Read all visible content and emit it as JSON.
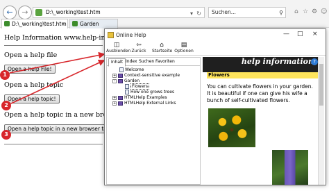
{
  "browser": {
    "url": "D:\\_working\\test.htm",
    "search_placeholder": "Suchen...",
    "tabs": [
      {
        "label": "D:\\_working\\test.htm"
      },
      {
        "label": "Garden"
      }
    ]
  },
  "page": {
    "header": "Help Information www.help-info.de",
    "sections": [
      {
        "text": "Open a help file",
        "button": "Open a help File!",
        "badge": "1"
      },
      {
        "text": "Open a help topic",
        "button": "Open a help topic!",
        "badge": "2"
      },
      {
        "text": "Open a help topic in a new browser tab",
        "button": "Open a help topic in a new browser tab!",
        "badge": "3"
      }
    ]
  },
  "help_window": {
    "title": "Online Help",
    "toolbar": [
      {
        "label": "Ausblenden",
        "icon": "hide-icon"
      },
      {
        "label": "Zurück",
        "icon": "back-icon"
      },
      {
        "label": "Startseite",
        "icon": "home-icon"
      },
      {
        "label": "Optionen",
        "icon": "options-icon"
      }
    ],
    "nav_tabs": [
      "Inhalt",
      "Index",
      "Suchen",
      "Favoriten"
    ],
    "tree": [
      {
        "label": "Welcome",
        "type": "page"
      },
      {
        "label": "Context-sensitive example",
        "type": "book"
      },
      {
        "label": "Garden",
        "type": "book"
      },
      {
        "label": "Flowers",
        "type": "page"
      },
      {
        "label": "How one grows trees",
        "type": "page"
      },
      {
        "label": "HTMLHelp Examples",
        "type": "book"
      },
      {
        "label": "HTMLHelp External Links",
        "type": "book"
      }
    ],
    "content": {
      "logo_text": "help information",
      "heading": "Flowers",
      "body": "You can cultivate flowers in your garden. It is beautiful if one can give his wife a bunch of self-cultivated flowers."
    }
  }
}
